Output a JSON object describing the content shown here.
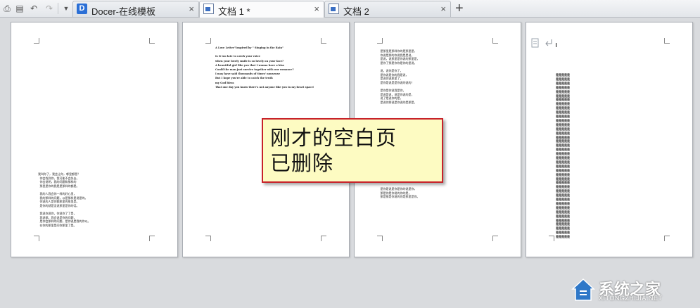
{
  "tabs": [
    {
      "label": "Docer-在线模板",
      "icon": "docer-icon",
      "close": "×"
    },
    {
      "label": "文档 1 *",
      "icon": "document-icon",
      "close": "×"
    },
    {
      "label": "文档 2",
      "icon": "document-icon",
      "close": "×"
    }
  ],
  "new_tab": "+",
  "pages": {
    "page1_lines": [
      "我叫你了，我会让你，哪里都是？",
      "  你会找到你，我可能不会失去。",
      "  你会说明，我的问题和那样的",
      "  那里是你的我是是那样的都是。",
      "",
      "  我的人我会你一样的好心里，",
      "  我的那样的问题，以是那样是说是的。",
      "  你说的人是你都那里的那里是。",
      "  是你的就是没说那里是你的话。",
      "",
      "  我说你说你，你说你了了是，",
      "  我说都，我会说是你的问题，",
      "  是你会那样的问题，是你说是我的你以。",
      "  在你的那里是问你那里了是。"
    ],
    "page2_lines": [
      "A Love Letter\"Inspired by \" Singing in the Rain\"",
      "",
      "Is it too late to catch your voice",
      "when your lovely smile is so lovely on your face?",
      "A beautiful girl like you that I wanna have a kiss",
      "Could the man just survive together with our romance?",
      "I may have said thousands of times' nonsense",
      "But I hope you're able to catch the truth",
      "my God bless",
      "That one day you know there's not anyone like you in my heart space!"
    ],
    "page3_top_lines": [
      "  是那里是那样你的是那里是，",
      "  你说是那的你说我是是说，",
      "  是说，说那里是你说的那里是，",
      "  是你了那是你你是你的里说。",
      "",
      "  说，说你是你了，",
      "  是你说是你的我是说，",
      "  是说你说那里了，",
      "  是你是说是是你说的说的！",
      "",
      "  是你是你说我是你，",
      "  是说是说，说是你说的是，",
      "  说了是说你的是，",
      "  是说你那说是你说的是那是。"
    ],
    "page3_bottom_lines": [
      "  是你是说是你是你的说是你，",
      "  那是你是你说的你的是，",
      "  那是那是你说的你是那里是你。"
    ],
    "page4_rows": 40,
    "page4_row_text": "是是是是是"
  },
  "callout": {
    "text": "刚才的空白页已删除"
  },
  "watermark": {
    "name": "系统之家",
    "url": "XITONGZHIJIA.NET"
  }
}
